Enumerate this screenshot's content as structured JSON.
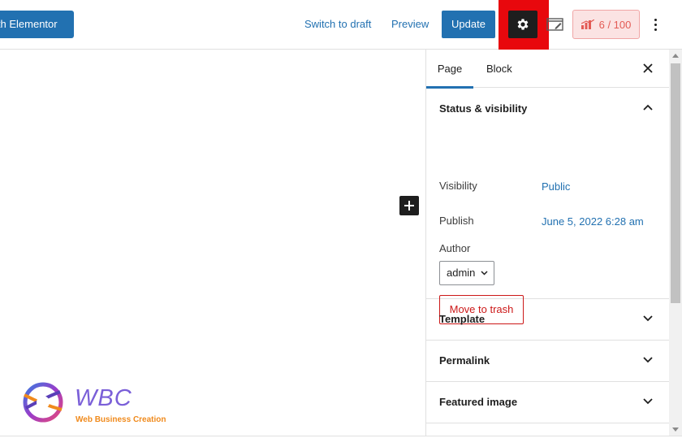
{
  "topbar": {
    "elementor_label": "ith Elementor",
    "switch_draft_label": "Switch to draft",
    "preview_label": "Preview",
    "update_label": "Update",
    "settings_icon": "gear-icon",
    "score_label": "6 / 100"
  },
  "branding": {
    "title": "WBC",
    "subtitle": "Web Business Creation"
  },
  "sidebar": {
    "tabs": [
      {
        "label": "Page",
        "active": true
      },
      {
        "label": "Block",
        "active": false
      }
    ],
    "status": {
      "title": "Status & visibility",
      "visibility_label": "Visibility",
      "visibility_value": "Public",
      "publish_label": "Publish",
      "publish_value": "June 5, 2022 6:28 am",
      "author_label": "Author",
      "author_value": "admin",
      "trash_label": "Move to trash"
    },
    "panels": [
      {
        "title": "Template"
      },
      {
        "title": "Permalink"
      },
      {
        "title": "Featured image"
      }
    ]
  },
  "colors": {
    "accent": "#2271b1",
    "highlight_frame": "#e8080d",
    "danger": "#cc1818",
    "score_text": "#e35b55"
  }
}
